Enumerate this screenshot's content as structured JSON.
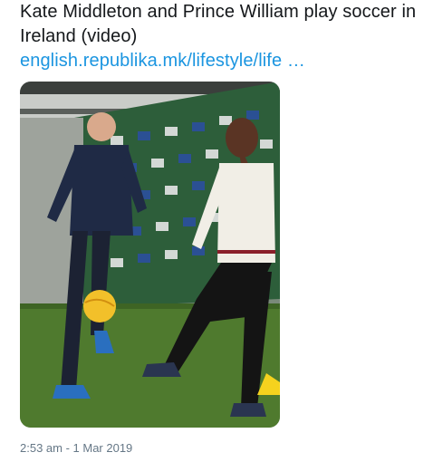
{
  "tweet": {
    "text": "Kate Middleton and Prince William play soccer in Ireland (video)",
    "link_text": "english.republika.mk/lifestyle/life  …",
    "timestamp": "2:53 am - 1 Mar 2019"
  },
  "media": {
    "kind": "photo",
    "colors": {
      "grass": "#4f7a2e",
      "ball": "#f2c02a",
      "stands_green": "#2e6b3f",
      "stands_blue": "#2b4f9e",
      "cone": "#f5d21e"
    }
  }
}
